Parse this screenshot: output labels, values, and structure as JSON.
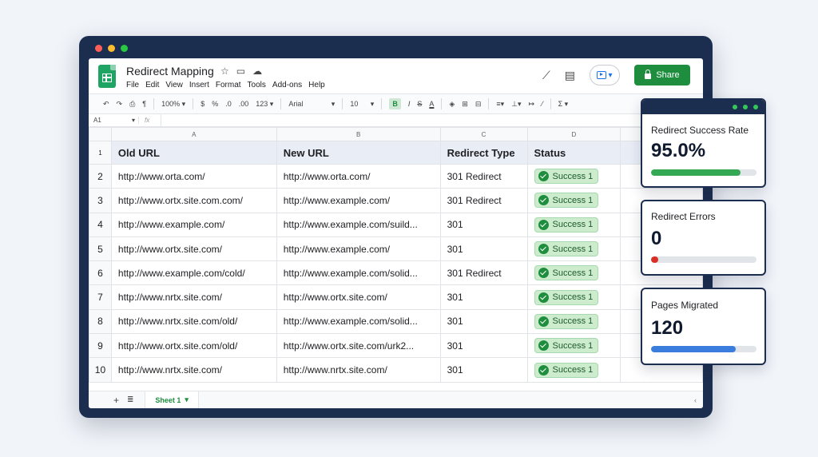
{
  "app": {
    "title": "Redirect Mapping",
    "menu": [
      "File",
      "Edit",
      "View",
      "Insert",
      "Format",
      "Tools",
      "Add-ons",
      "Help"
    ],
    "share_label": "Share"
  },
  "toolbar": {
    "zoom": "100%",
    "currency": "$",
    "percent": "%",
    "decimal_decrease": ".0",
    "decimal_increase": ".00",
    "number_format": "123",
    "font": "Arial",
    "font_size": "10",
    "bold": "B",
    "italic": "I",
    "strike": "S",
    "text_color": "A",
    "sum": "Σ"
  },
  "formula_bar": {
    "cell_ref": "A1",
    "fx": "fx"
  },
  "grid": {
    "columns": [
      "A",
      "B",
      "C",
      "D"
    ],
    "header_row": {
      "num": "1",
      "cells": [
        "Old URL",
        "New URL",
        "Redirect Type",
        "Status"
      ]
    },
    "rows": [
      {
        "num": "2",
        "old": "http://www.orta.com/",
        "new": "http://www.orta.com/",
        "type": "301 Redirect",
        "status": "Success 1"
      },
      {
        "num": "3",
        "old": "http://www.ortx.site.com.com/",
        "new": "http://www.example.com/",
        "type": "301 Redirect",
        "status": "Success 1"
      },
      {
        "num": "4",
        "old": "http://www.example.com/",
        "new": "http://www.example.com/suild...",
        "type": "301",
        "status": "Success 1"
      },
      {
        "num": "5",
        "old": "http://www.ortx.site.com/",
        "new": "http://www.example.com/",
        "type": "301",
        "status": "Success 1"
      },
      {
        "num": "6",
        "old": "http://www.example.com/cold/",
        "new": "http://www.example.com/solid...",
        "type": "301 Redirect",
        "status": "Success 1"
      },
      {
        "num": "7",
        "old": "http://www.nrtx.site.com/",
        "new": "http://www.ortx.site.com/",
        "type": "301",
        "status": "Success 1"
      },
      {
        "num": "8",
        "old": "http://www.nrtx.site.com/old/",
        "new": "http://www.example.com/solid...",
        "type": "301",
        "status": "Success 1"
      },
      {
        "num": "9",
        "old": "http://www.ortx.site.com/old/",
        "new": "http://www.ortx.site.com/urk2...",
        "type": "301",
        "status": "Success 1"
      },
      {
        "num": "10",
        "old": "http://www.nrtx.site.com/",
        "new": "http://www.nrtx.site.com/",
        "type": "301",
        "status": "Success 1"
      }
    ]
  },
  "sheets": {
    "add": "+",
    "active": "Sheet 1"
  },
  "metrics": [
    {
      "title": "Redirect Success Rate",
      "value": "95.0%",
      "progress": 0.85,
      "color": "#34a853"
    },
    {
      "title": "Redirect Errors",
      "value": "0",
      "progress": 0.07,
      "color": "#d93025"
    },
    {
      "title": "Pages Migrated",
      "value": "120",
      "progress": 0.8,
      "color": "#3b7ddd"
    }
  ]
}
